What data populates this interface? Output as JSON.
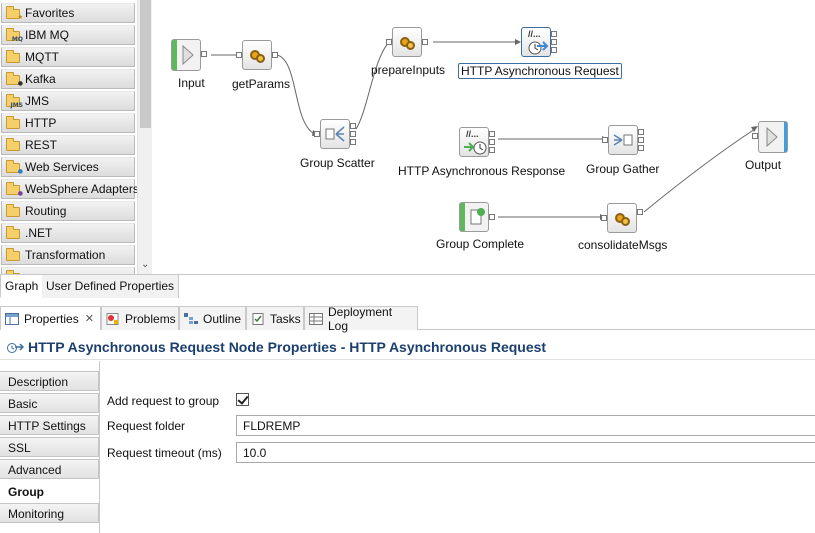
{
  "palette": {
    "items": [
      {
        "label": "Favorites",
        "icon": "folder-star-icon"
      },
      {
        "label": "IBM MQ",
        "icon": "folder-mq-icon"
      },
      {
        "label": "MQTT",
        "icon": "folder-mqtt-icon"
      },
      {
        "label": "Kafka",
        "icon": "folder-kafka-icon"
      },
      {
        "label": "JMS",
        "icon": "folder-jms-icon"
      },
      {
        "label": "HTTP",
        "icon": "folder-http-icon"
      },
      {
        "label": "REST",
        "icon": "folder-rest-icon"
      },
      {
        "label": "Web Services",
        "icon": "folder-webservices-icon"
      },
      {
        "label": "WebSphere Adapters",
        "icon": "folder-adapters-icon"
      },
      {
        "label": "Routing",
        "icon": "folder-routing-icon"
      },
      {
        "label": ".NET",
        "icon": "folder-dotnet-icon"
      },
      {
        "label": "Transformation",
        "icon": "folder-transformation-icon"
      }
    ],
    "badges": [
      "",
      "MQ",
      "",
      "",
      "JMS",
      "",
      "",
      "",
      "",
      "",
      "",
      ""
    ]
  },
  "flow": {
    "nodes": {
      "input": "Input",
      "getparams": "getParams",
      "prepareinputs": "prepareInputs",
      "http_async_request": "HTTP Asynchronous Request",
      "group_scatter": "Group Scatter",
      "http_async_response": "HTTP Asynchronous Response",
      "group_gather": "Group Gather",
      "output": "Output",
      "group_complete": "Group Complete",
      "consolidatemsgs": "consolidateMsgs"
    },
    "icon_text": "//..."
  },
  "editor_tabs": {
    "graph": "Graph",
    "user_defined_properties": "User Defined Properties"
  },
  "views": {
    "properties": "Properties",
    "problems": "Problems",
    "outline": "Outline",
    "tasks": "Tasks",
    "deployment_log": "Deployment Log",
    "close_glyph": "✕"
  },
  "properties": {
    "title": "HTTP Asynchronous Request Node Properties - HTTP Asynchronous Request",
    "tabs": [
      "Description",
      "Basic",
      "HTTP Settings",
      "SSL",
      "Advanced",
      "Group",
      "Monitoring"
    ],
    "active_tab": "Group",
    "fields": {
      "add_request_label": "Add request to group",
      "add_request_checked": true,
      "request_folder_label": "Request folder",
      "request_folder_value": "FLDREMP",
      "request_timeout_label": "Request timeout (ms)",
      "request_timeout_value": "10.0"
    }
  },
  "colors": {
    "title_blue": "#1c3f6e",
    "gear_orange": "#e8a317",
    "terminal_green": "#4caf50",
    "output_blue": "#3aa0e0"
  }
}
